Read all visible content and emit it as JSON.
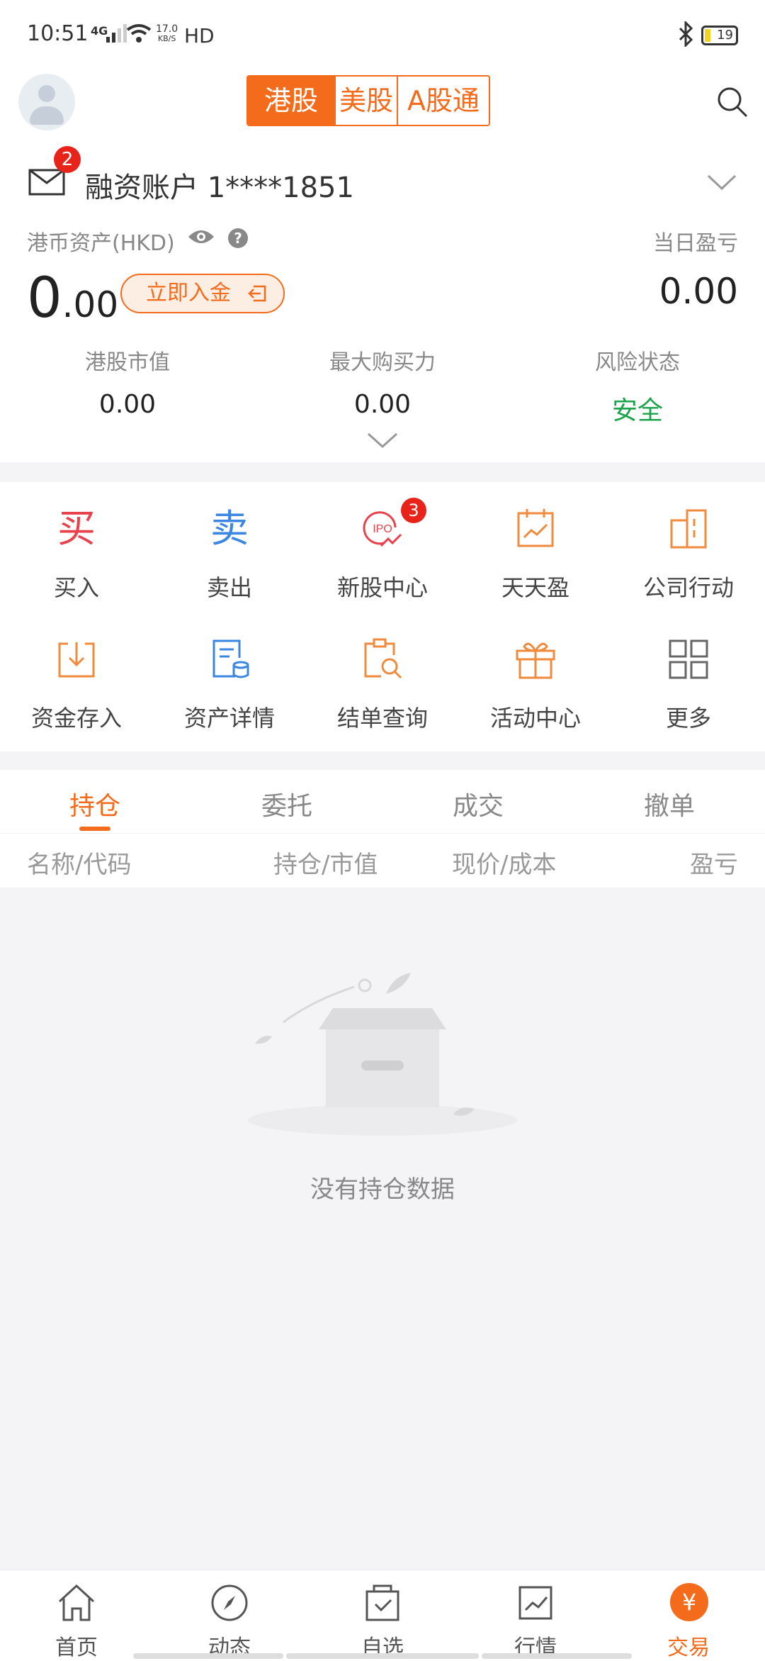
{
  "status": {
    "time": "10:51",
    "signal": "4G",
    "net_speed_value": "17.0",
    "net_speed_unit": "KB/S",
    "hd": "HD",
    "battery": "19"
  },
  "header": {
    "market_tabs": [
      "港股",
      "美股",
      "A股通"
    ],
    "active_tab": "港股"
  },
  "account": {
    "unread_count": "2",
    "name": "融资账户 1****1851",
    "asset_label": "港币资产(HKD)",
    "help": "?",
    "daily_pnl_label": "当日盈亏",
    "balance_int": "0",
    "balance_dec": ".00",
    "deposit_label": "立即入金",
    "daily_pnl_value": "0.00",
    "stats": [
      {
        "label": "港股市值",
        "value": "0.00"
      },
      {
        "label": "最大购买力",
        "value": "0.00"
      },
      {
        "label": "风险状态",
        "value": "安全"
      }
    ]
  },
  "actions": [
    {
      "label": "买入",
      "icon": "buy-icon",
      "glyph": "买"
    },
    {
      "label": "卖出",
      "icon": "sell-icon",
      "glyph": "卖"
    },
    {
      "label": "新股中心",
      "icon": "ipo-icon",
      "badge": "3",
      "glyph": "IPO"
    },
    {
      "label": "天天盈",
      "icon": "calendar-chart-icon"
    },
    {
      "label": "公司行动",
      "icon": "building-icon"
    },
    {
      "label": "资金存入",
      "icon": "deposit-icon"
    },
    {
      "label": "资产详情",
      "icon": "asset-detail-icon"
    },
    {
      "label": "结单查询",
      "icon": "statement-search-icon"
    },
    {
      "label": "活动中心",
      "icon": "gift-icon"
    },
    {
      "label": "更多",
      "icon": "grid-more-icon"
    }
  ],
  "tabs": [
    "持仓",
    "委托",
    "成交",
    "撤单"
  ],
  "columns": [
    "名称/代码",
    "持仓/市值",
    "现价/成本",
    "盈亏"
  ],
  "empty_text": "没有持仓数据",
  "nav": [
    {
      "label": "首页",
      "icon": "home-icon"
    },
    {
      "label": "动态",
      "icon": "compass-icon"
    },
    {
      "label": "自选",
      "icon": "watchlist-icon"
    },
    {
      "label": "行情",
      "icon": "market-chart-icon"
    },
    {
      "label": "交易",
      "icon": "yen-icon",
      "glyph": "¥"
    }
  ],
  "colors": {
    "accent": "#f36b1b",
    "safe": "#1aa34a",
    "badge": "#e8231a",
    "buy": "#e8414b",
    "sell": "#3a86e0"
  }
}
